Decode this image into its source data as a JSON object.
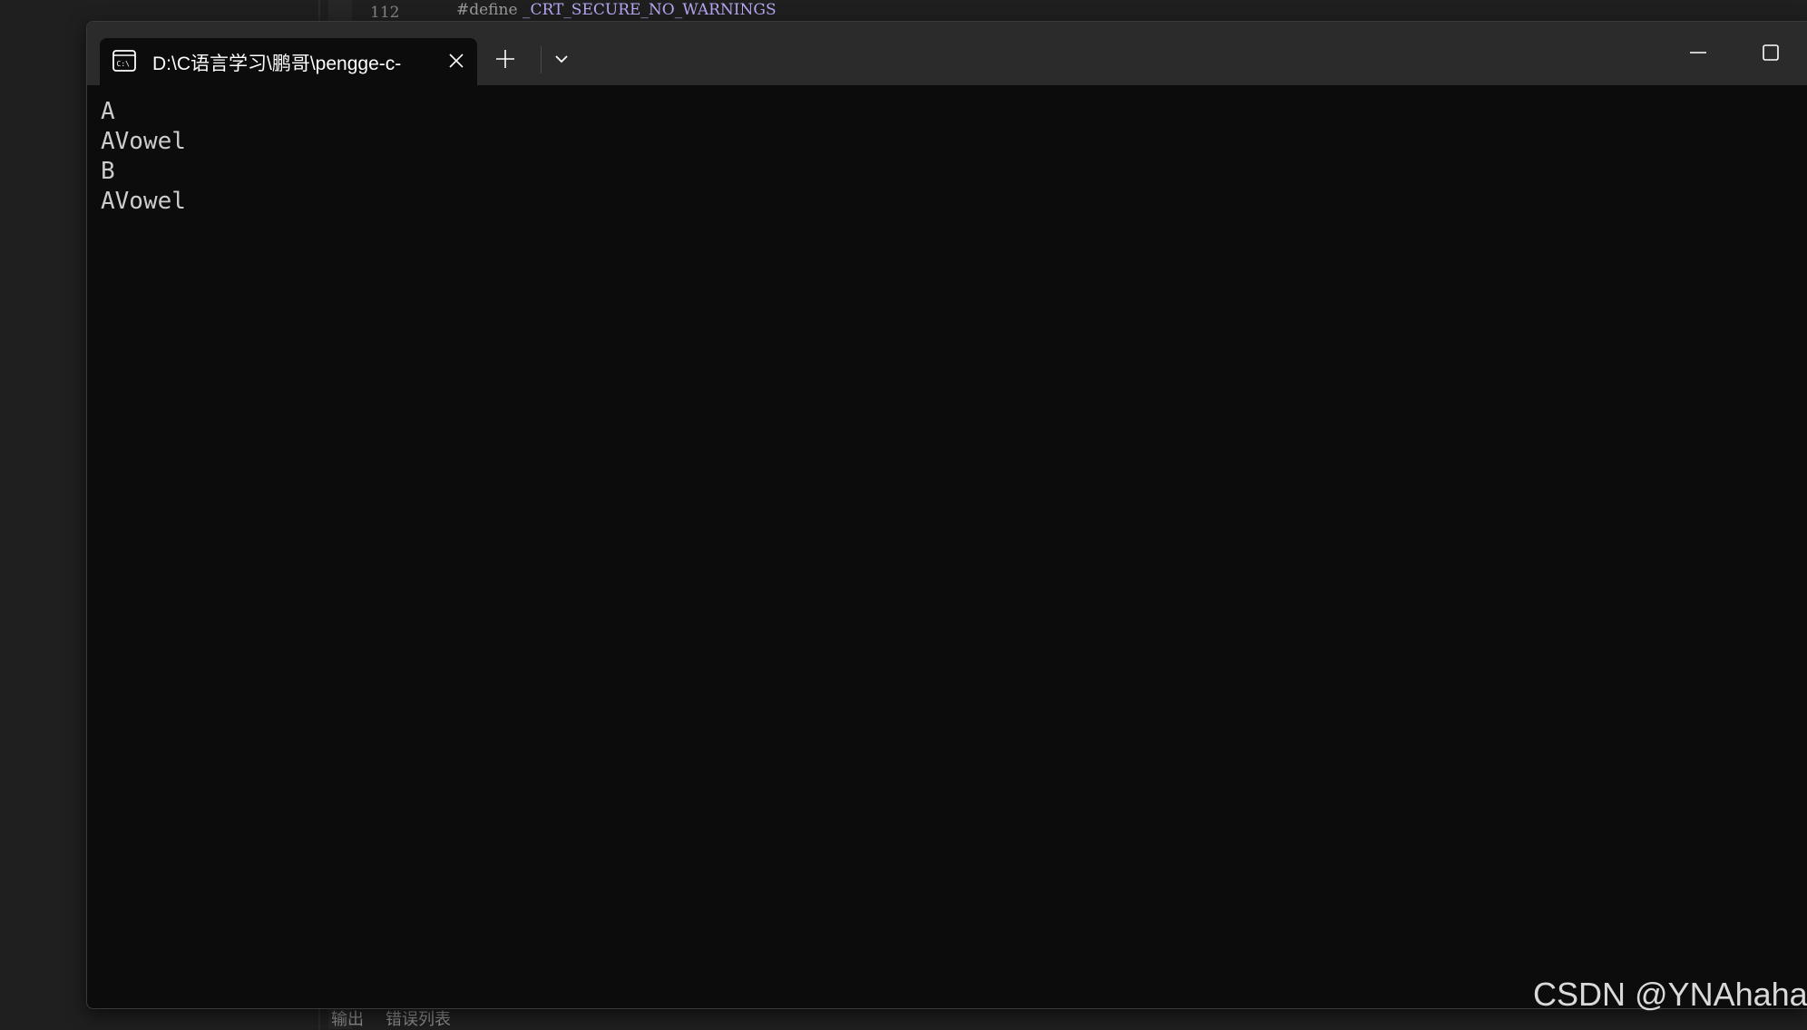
{
  "editor": {
    "line_number": "112",
    "code_keyword": "#define",
    "code_macro": "_CRT_SECURE_NO_WARNINGS",
    "bottom_tabs": [
      "输出",
      "错误列表"
    ]
  },
  "terminal": {
    "tab_title": "D:\\C语言学习\\鹏哥\\pengge-c-",
    "tab_icon": "console-icon",
    "output_lines": [
      "A",
      "AVowel",
      "B",
      "AVowel"
    ]
  },
  "watermark": "CSDN @YNAhaha",
  "colors": {
    "terminal_bg": "#0c0c0c",
    "titlebar_bg": "#2b2b2b",
    "console_text": "#cccccc",
    "macro_color": "#b8a7f2"
  }
}
